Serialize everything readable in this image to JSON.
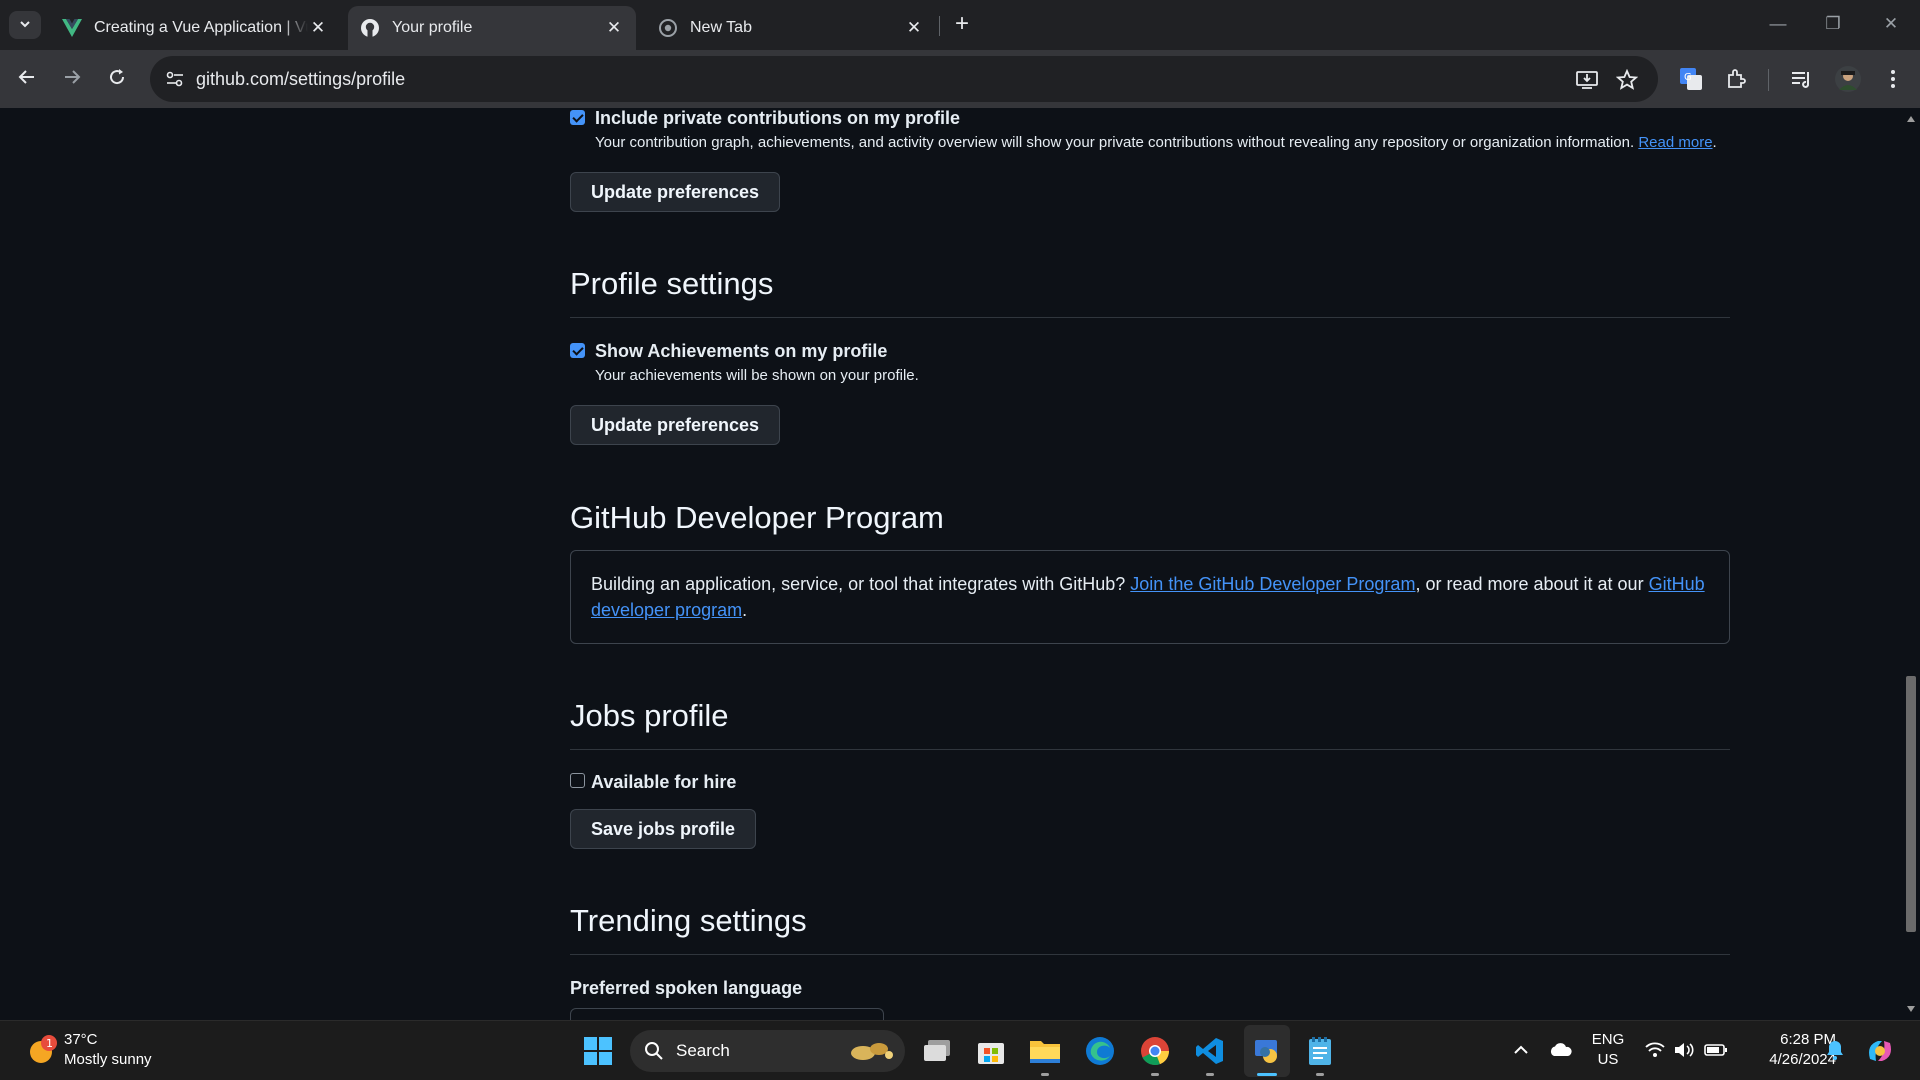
{
  "browser": {
    "tabs": [
      {
        "title": "Creating a Vue Application | Vue",
        "active": false
      },
      {
        "title": "Your profile",
        "active": true
      },
      {
        "title": "New Tab",
        "active": false
      }
    ],
    "url": "github.com/settings/profile"
  },
  "page": {
    "private_contributions": {
      "checked": true,
      "label": "Include private contributions on my profile",
      "note": "Your contribution graph, achievements, and activity overview will show your private contributions without revealing any repository or organization information.",
      "link": "Read more",
      "end": ".",
      "button": "Update preferences"
    },
    "profile_settings": {
      "heading": "Profile settings",
      "checked": true,
      "label": "Show Achievements on my profile",
      "note": "Your achievements will be shown on your profile.",
      "button": "Update preferences"
    },
    "developer_program": {
      "heading": "GitHub Developer Program",
      "text_before": "Building an application, service, or tool that integrates with GitHub? ",
      "link1": "Join the GitHub Developer Program",
      "text_middle": ", or read more about it at our ",
      "link2": "GitHub developer program",
      "text_end": "."
    },
    "jobs_profile": {
      "heading": "Jobs profile",
      "checked": false,
      "label": "Available for hire",
      "button": "Save jobs profile"
    },
    "trending_settings": {
      "heading": "Trending settings",
      "label": "Preferred spoken language"
    }
  },
  "taskbar": {
    "weather": {
      "temp": "37°C",
      "condition": "Mostly sunny",
      "badge": "1"
    },
    "search_placeholder": "Search",
    "language": {
      "line1": "ENG",
      "line2": "US"
    },
    "clock": {
      "time": "6:28 PM",
      "date": "4/26/2024"
    }
  },
  "colors": {
    "accent": "#4493f8",
    "page_bg": "#0d1117",
    "chrome_bg": "#35363a"
  }
}
